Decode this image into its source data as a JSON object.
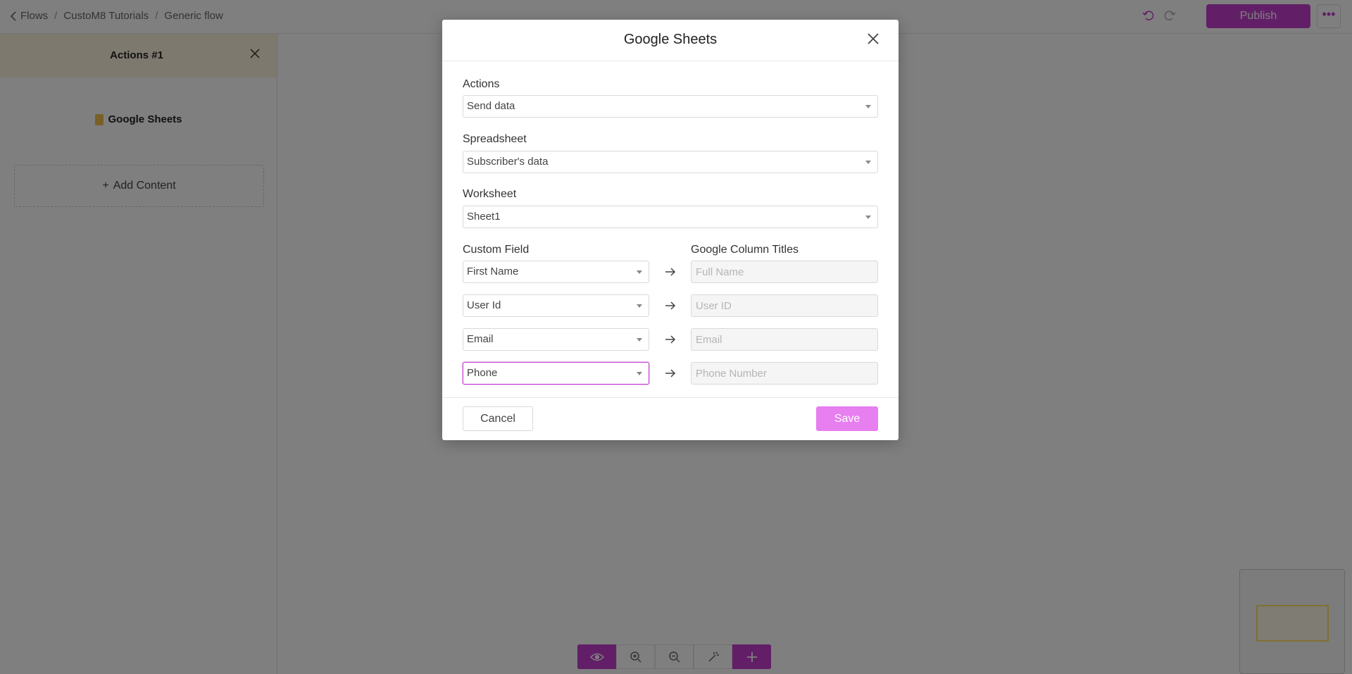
{
  "breadcrumb": {
    "items": [
      "Flows",
      "CustoM8 Tutorials",
      "Generic flow"
    ]
  },
  "topbar": {
    "publish_label": "Publish",
    "more_label": "•••"
  },
  "sidebar": {
    "title": "Actions #1",
    "item_label": "Google Sheets",
    "add_content_label": "Add Content"
  },
  "modal": {
    "title": "Google Sheets",
    "actions_label": "Actions",
    "actions_value": "Send data",
    "spreadsheet_label": "Spreadsheet",
    "spreadsheet_value": "Subscriber's data",
    "worksheet_label": "Worksheet",
    "worksheet_value": "Sheet1",
    "custom_field_header": "Custom Field",
    "column_titles_header": "Google Column Titles",
    "mappings": [
      {
        "field": "First Name",
        "column_placeholder": "Full Name"
      },
      {
        "field": "User Id",
        "column_placeholder": "User ID"
      },
      {
        "field": "Email",
        "column_placeholder": "Email"
      },
      {
        "field": "Phone",
        "column_placeholder": "Phone Number"
      }
    ],
    "cancel_label": "Cancel",
    "save_label": "Save"
  },
  "colors": {
    "accent": "#c43fcf",
    "save_button": "#e77ff0",
    "sidebar_header": "#fdf3dc"
  }
}
